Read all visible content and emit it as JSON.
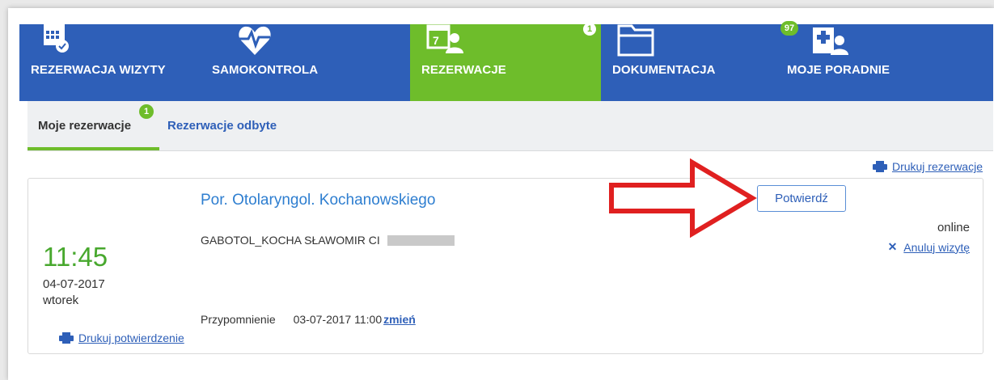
{
  "nav": {
    "items": [
      {
        "label": "REZERWACJA WIZYTY",
        "icon": "calendar-check-icon",
        "active": false
      },
      {
        "label": "SAMOKONTROLA",
        "icon": "heart-pulse-icon",
        "active": false
      },
      {
        "label": "REZERWACJE",
        "icon": "calendar-user-icon",
        "active": true,
        "badge": "1"
      },
      {
        "label": "DOKUMENTACJA",
        "icon": "folder-icon",
        "active": false
      },
      {
        "label": "MOJE PORADNIE",
        "icon": "hospital-user-icon",
        "active": false,
        "badge": "97"
      }
    ],
    "calendar_day": "7"
  },
  "subtabs": {
    "active_label": "Moje rezerwacje",
    "active_badge": "1",
    "other_label": "Rezerwacje odbyte"
  },
  "print_reservations": "Drukuj rezerwacje",
  "reservation": {
    "time": "11:45",
    "date": "04-07-2017",
    "weekday": "wtorek",
    "clinic": "Por. Otolaryngol. Kochanowskiego",
    "doctor": "GABOTOL_KOCHA SŁAWOMIR CI",
    "reminder_label": "Przypomnienie",
    "reminder_value": "03-07-2017 11:00",
    "reminder_change": "zmień",
    "print_confirmation": "Drukuj potwierdzenie",
    "confirm_button": "Potwierdź",
    "mode": "online",
    "cancel_mark": "✕",
    "cancel_label": "Anuluj wizytę"
  },
  "colors": {
    "nav_blue": "#2e5fb8",
    "active_green": "#6ebd2b",
    "time_green": "#48a82e",
    "arrow_red": "#e02020"
  }
}
